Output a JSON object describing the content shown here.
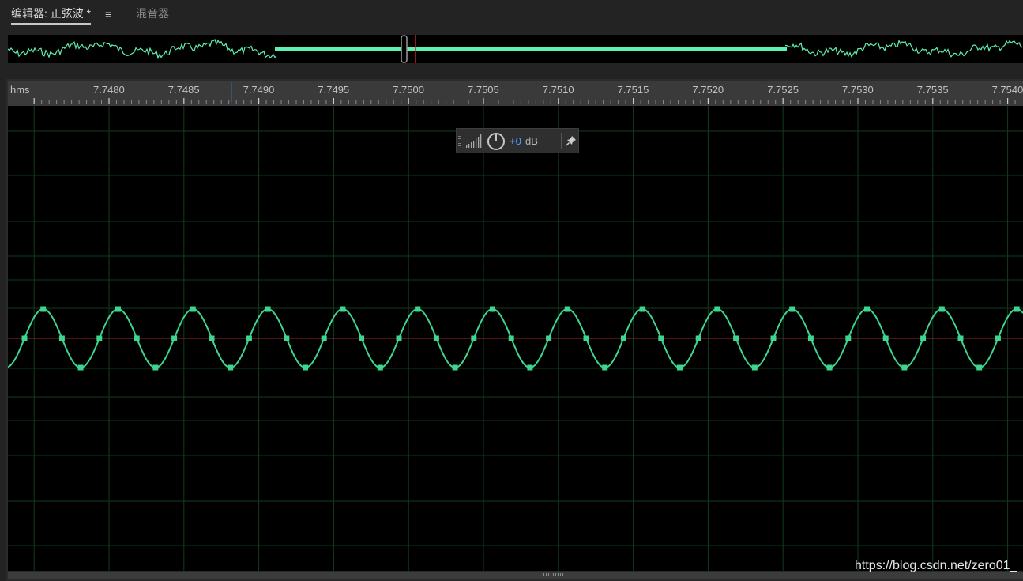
{
  "tabs": {
    "editor_label": "编辑器: 正弦波 *",
    "menu_glyph": "≡",
    "mixer_label": "混音器"
  },
  "ruler": {
    "unit": "hms",
    "ticks": [
      "7.7480",
      "7.7485",
      "7.7490",
      "7.7495",
      "7.7500",
      "7.7505",
      "7.7510",
      "7.7515",
      "7.7520",
      "7.7525",
      "7.7530",
      "7.7535",
      "7.7540"
    ]
  },
  "hud": {
    "gain_value": "+0",
    "gain_unit": "dB",
    "icons": [
      "drag-handle-icon",
      "level-bars-icon",
      "volume-knob-icon",
      "pin-icon"
    ]
  },
  "colors": {
    "waveform": "#3ed68f",
    "overview_waveform": "#5ff0b0",
    "centerline": "#8a1a1a",
    "grid": "#103c1c",
    "playhead": "#c0232a",
    "gain_value": "#4fa3ff"
  },
  "waveform": {
    "cycles_visible": 13.5,
    "samples_per_cycle": 4
  },
  "watermark": "https://blog.csdn.net/zero01_"
}
